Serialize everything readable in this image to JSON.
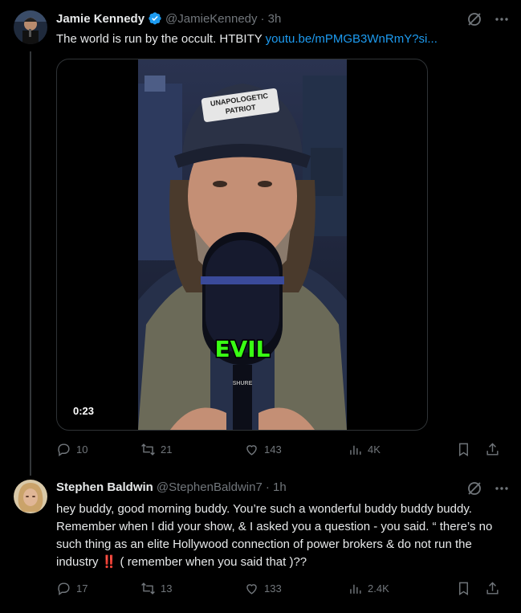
{
  "tweet1": {
    "name": "Jamie Kennedy",
    "handle": "@JamieKennedy",
    "time": "· 3h",
    "text": "The world is run by the occult. HTBITY ",
    "link": "youtu.be/mPMGB3WnRmY?si...",
    "video": {
      "duration": "0:23",
      "caption": "EVIL",
      "cap_line1": "UNAPOLOGETIC",
      "cap_line2": "PATRIOT",
      "mic_brand": "SHURE"
    },
    "actions": {
      "replies": "10",
      "reposts": "21",
      "likes": "143",
      "views": "4K"
    }
  },
  "tweet2": {
    "name": "Stephen Baldwin",
    "handle": "@StephenBaldwin7",
    "time": "· 1h",
    "text": "hey buddy, good morning buddy. You’re such a wonderful buddy buddy buddy. Remember when I did your show, & I asked you a question - you said. “ there’s no such thing as an elite Hollywood connection of power brokers & do not run the industry ‼️ ( remember when you said that )??",
    "actions": {
      "replies": "17",
      "reposts": "13",
      "likes": "133",
      "views": "2.4K"
    }
  },
  "colors": {
    "accent": "#1d9bf0",
    "muted": "#71767b",
    "text": "#e7e9ea",
    "background": "#000000",
    "caption_green": "#39ff14"
  },
  "icons": [
    "grok-icon",
    "more-icon",
    "reply-icon",
    "repost-icon",
    "like-icon",
    "views-icon",
    "bookmark-icon",
    "share-icon",
    "verified-icon"
  ]
}
